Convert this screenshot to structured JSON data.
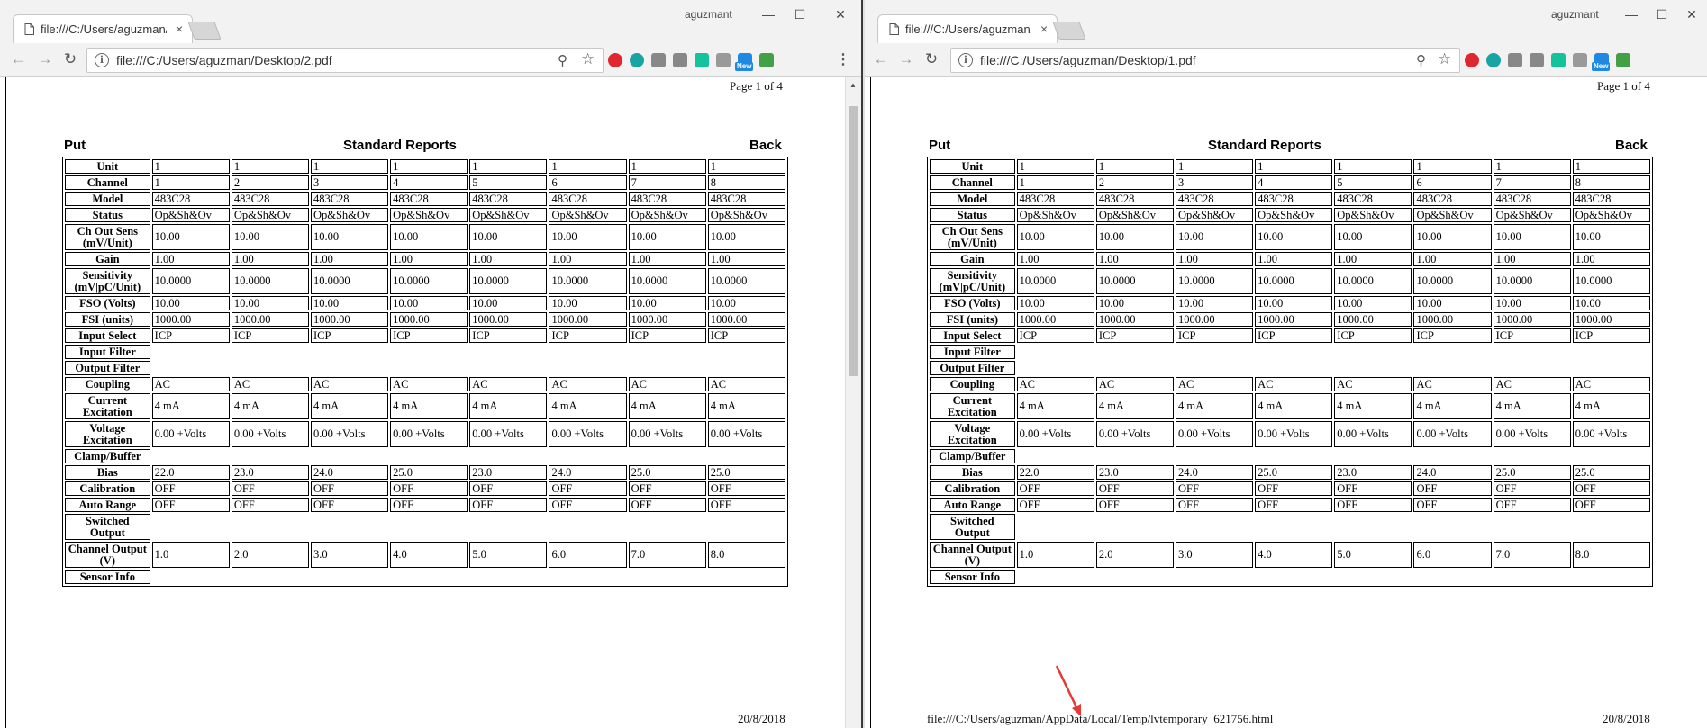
{
  "left": {
    "tab_title": "file:///C:/Users/aguzman/",
    "close_glyph": "×",
    "user": "aguzmant",
    "url": "file:///C:/Users/aguzman/Desktop/2.pdf",
    "page_indicator": "Page 1 of 4",
    "heading_left": "Put",
    "heading_center": "Standard Reports",
    "heading_right": "Back",
    "footer_url": "",
    "footer_date": "20/8/2018",
    "rows": [
      {
        "label": "Unit",
        "values": [
          "1",
          "1",
          "1",
          "1",
          "1",
          "1",
          "1",
          "1"
        ]
      },
      {
        "label": "Channel",
        "values": [
          "1",
          "2",
          "3",
          "4",
          "5",
          "6",
          "7",
          "8"
        ]
      },
      {
        "label": "Model",
        "values": [
          "483C28",
          "483C28",
          "483C28",
          "483C28",
          "483C28",
          "483C28",
          "483C28",
          "483C28"
        ]
      },
      {
        "label": "Status",
        "values": [
          "Op&Sh&Ov",
          "Op&Sh&Ov",
          "Op&Sh&Ov",
          "Op&Sh&Ov",
          "Op&Sh&Ov",
          "Op&Sh&Ov",
          "Op&Sh&Ov",
          "Op&Sh&Ov"
        ]
      },
      {
        "label": "Ch Out Sens (mV/Unit)",
        "values": [
          "10.00",
          "10.00",
          "10.00",
          "10.00",
          "10.00",
          "10.00",
          "10.00",
          "10.00"
        ]
      },
      {
        "label": "Gain",
        "values": [
          "1.00",
          "1.00",
          "1.00",
          "1.00",
          "1.00",
          "1.00",
          "1.00",
          "1.00"
        ]
      },
      {
        "label": "Sensitivity (mV|pC/Unit)",
        "values": [
          "10.0000",
          "10.0000",
          "10.0000",
          "10.0000",
          "10.0000",
          "10.0000",
          "10.0000",
          "10.0000"
        ]
      },
      {
        "label": "FSO (Volts)",
        "values": [
          "10.00",
          "10.00",
          "10.00",
          "10.00",
          "10.00",
          "10.00",
          "10.00",
          "10.00"
        ]
      },
      {
        "label": "FSI (units)",
        "values": [
          "1000.00",
          "1000.00",
          "1000.00",
          "1000.00",
          "1000.00",
          "1000.00",
          "1000.00",
          "1000.00"
        ]
      },
      {
        "label": "Input Select",
        "values": [
          "ICP",
          "ICP",
          "ICP",
          "ICP",
          "ICP",
          "ICP",
          "ICP",
          "ICP"
        ]
      },
      {
        "label": "Input Filter",
        "values": []
      },
      {
        "label": "Output Filter",
        "values": []
      },
      {
        "label": "Coupling",
        "values": [
          "AC",
          "AC",
          "AC",
          "AC",
          "AC",
          "AC",
          "AC",
          "AC"
        ]
      },
      {
        "label": "Current Excitation",
        "values": [
          "4 mA",
          "4 mA",
          "4 mA",
          "4 mA",
          "4 mA",
          "4 mA",
          "4 mA",
          "4 mA"
        ]
      },
      {
        "label": "Voltage Excitation",
        "values": [
          "0.00 +Volts",
          "0.00 +Volts",
          "0.00 +Volts",
          "0.00 +Volts",
          "0.00 +Volts",
          "0.00 +Volts",
          "0.00 +Volts",
          "0.00 +Volts"
        ]
      },
      {
        "label": "Clamp/Buffer",
        "values": []
      },
      {
        "label": "Bias",
        "values": [
          "22.0",
          "23.0",
          "24.0",
          "25.0",
          "23.0",
          "24.0",
          "25.0",
          "25.0"
        ]
      },
      {
        "label": "Calibration",
        "values": [
          "OFF",
          "OFF",
          "OFF",
          "OFF",
          "OFF",
          "OFF",
          "OFF",
          "OFF"
        ]
      },
      {
        "label": "Auto Range",
        "values": [
          "OFF",
          "OFF",
          "OFF",
          "OFF",
          "OFF",
          "OFF",
          "OFF",
          "OFF"
        ]
      },
      {
        "label": "Switched Output",
        "values": []
      },
      {
        "label": "Channel Output (V)",
        "values": [
          "1.0",
          "2.0",
          "3.0",
          "4.0",
          "5.0",
          "6.0",
          "7.0",
          "8.0"
        ]
      },
      {
        "label": "Sensor Info",
        "values": []
      }
    ]
  },
  "right": {
    "tab_title": "file:///C:/Users/aguzman/",
    "close_glyph": "×",
    "user": "aguzmant",
    "url": "file:///C:/Users/aguzman/Desktop/1.pdf",
    "page_indicator": "Page 1 of 4",
    "heading_left": "Put",
    "heading_center": "Standard Reports",
    "heading_right": "Back",
    "footer_url": "file:///C:/Users/aguzman/AppData/Local/Temp/lvtemporary_621756.html",
    "footer_date": "20/8/2018",
    "rows": [
      {
        "label": "Unit",
        "values": [
          "1",
          "1",
          "1",
          "1",
          "1",
          "1",
          "1",
          "1"
        ]
      },
      {
        "label": "Channel",
        "values": [
          "1",
          "2",
          "3",
          "4",
          "5",
          "6",
          "7",
          "8"
        ]
      },
      {
        "label": "Model",
        "values": [
          "483C28",
          "483C28",
          "483C28",
          "483C28",
          "483C28",
          "483C28",
          "483C28",
          "483C28"
        ]
      },
      {
        "label": "Status",
        "values": [
          "Op&Sh&Ov",
          "Op&Sh&Ov",
          "Op&Sh&Ov",
          "Op&Sh&Ov",
          "Op&Sh&Ov",
          "Op&Sh&Ov",
          "Op&Sh&Ov",
          "Op&Sh&Ov"
        ]
      },
      {
        "label": "Ch Out Sens (mV/Unit)",
        "values": [
          "10.00",
          "10.00",
          "10.00",
          "10.00",
          "10.00",
          "10.00",
          "10.00",
          "10.00"
        ]
      },
      {
        "label": "Gain",
        "values": [
          "1.00",
          "1.00",
          "1.00",
          "1.00",
          "1.00",
          "1.00",
          "1.00",
          "1.00"
        ]
      },
      {
        "label": "Sensitivity (mV|pC/Unit)",
        "values": [
          "10.0000",
          "10.0000",
          "10.0000",
          "10.0000",
          "10.0000",
          "10.0000",
          "10.0000",
          "10.0000"
        ]
      },
      {
        "label": "FSO (Volts)",
        "values": [
          "10.00",
          "10.00",
          "10.00",
          "10.00",
          "10.00",
          "10.00",
          "10.00",
          "10.00"
        ]
      },
      {
        "label": "FSI (units)",
        "values": [
          "1000.00",
          "1000.00",
          "1000.00",
          "1000.00",
          "1000.00",
          "1000.00",
          "1000.00",
          "1000.00"
        ]
      },
      {
        "label": "Input Select",
        "values": [
          "ICP",
          "ICP",
          "ICP",
          "ICP",
          "ICP",
          "ICP",
          "ICP",
          "ICP"
        ]
      },
      {
        "label": "Input Filter",
        "values": []
      },
      {
        "label": "Output Filter",
        "values": []
      },
      {
        "label": "Coupling",
        "values": [
          "AC",
          "AC",
          "AC",
          "AC",
          "AC",
          "AC",
          "AC",
          "AC"
        ]
      },
      {
        "label": "Current Excitation",
        "values": [
          "4 mA",
          "4 mA",
          "4 mA",
          "4 mA",
          "4 mA",
          "4 mA",
          "4 mA",
          "4 mA"
        ]
      },
      {
        "label": "Voltage Excitation",
        "values": [
          "0.00 +Volts",
          "0.00 +Volts",
          "0.00 +Volts",
          "0.00 +Volts",
          "0.00 +Volts",
          "0.00 +Volts",
          "0.00 +Volts",
          "0.00 +Volts"
        ]
      },
      {
        "label": "Clamp/Buffer",
        "values": []
      },
      {
        "label": "Bias",
        "values": [
          "22.0",
          "23.0",
          "24.0",
          "25.0",
          "23.0",
          "24.0",
          "25.0",
          "25.0"
        ]
      },
      {
        "label": "Calibration",
        "values": [
          "OFF",
          "OFF",
          "OFF",
          "OFF",
          "OFF",
          "OFF",
          "OFF",
          "OFF"
        ]
      },
      {
        "label": "Auto Range",
        "values": [
          "OFF",
          "OFF",
          "OFF",
          "OFF",
          "OFF",
          "OFF",
          "OFF",
          "OFF"
        ]
      },
      {
        "label": "Switched Output",
        "values": []
      },
      {
        "label": "Channel Output (V)",
        "values": [
          "1.0",
          "2.0",
          "3.0",
          "4.0",
          "5.0",
          "6.0",
          "7.0",
          "8.0"
        ]
      },
      {
        "label": "Sensor Info",
        "values": []
      }
    ]
  },
  "icons": {
    "back": "back-arrow-icon",
    "forward": "forward-arrow-icon",
    "reload": "reload-icon",
    "info": "info-icon",
    "zoom": "zoom-icon",
    "bookmark": "star-icon",
    "menu": "kebab-menu-icon"
  },
  "extensions": [
    {
      "name": "opera-icon",
      "color": "#e0262e"
    },
    {
      "name": "m-extension-icon",
      "color": "#1aa3a3"
    },
    {
      "name": "sr-extension-icon",
      "color": "#888888"
    },
    {
      "name": "flag-extension-icon",
      "color": "#888888"
    },
    {
      "name": "grammarly-icon",
      "color": "#15c39a"
    },
    {
      "name": "image-extension-icon",
      "color": "#9a9a9a"
    },
    {
      "name": "new-extension-icon",
      "color": "#1e88e5",
      "badge": "New"
    },
    {
      "name": "save-extension-icon",
      "color": "#43a047"
    }
  ],
  "colors": {
    "chrome_bar": "#f2f2f2",
    "annotation_arrow": "#e53935"
  }
}
